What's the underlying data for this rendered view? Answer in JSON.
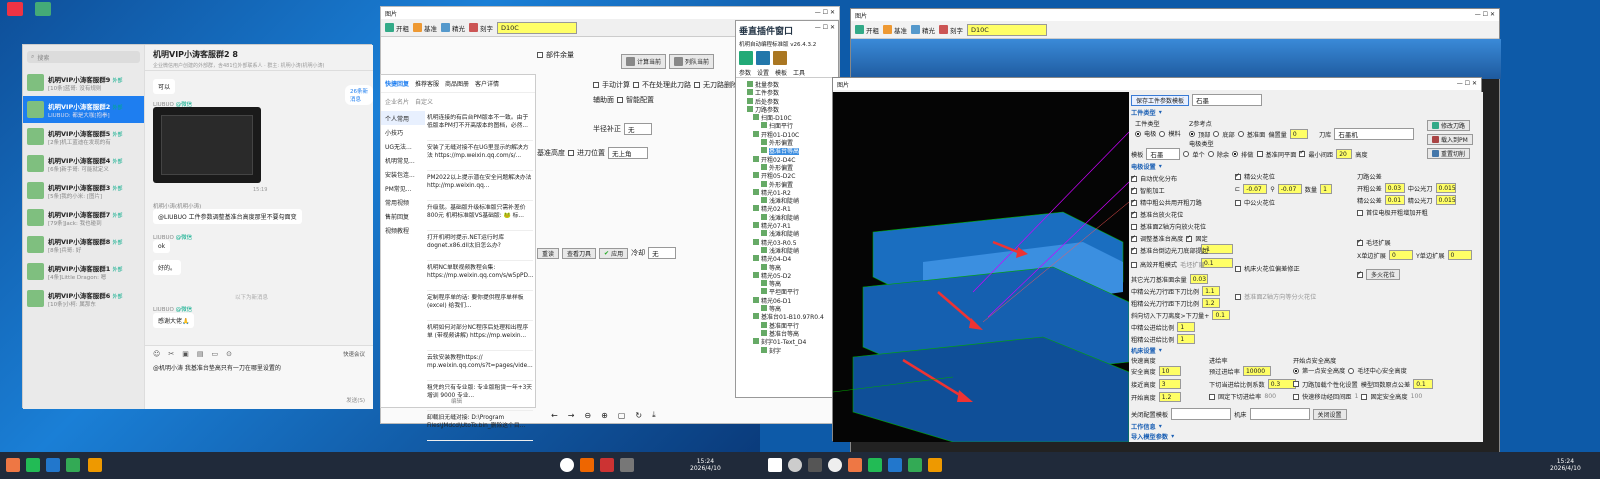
{
  "wechat": {
    "search_placeholder": "搜索",
    "add_icon": "plus-icon",
    "chats": [
      {
        "name": "机明VIP小涛客服群9",
        "badge": "外部",
        "preview": "[10条]蓝哥: 没有规则",
        "time": "",
        "active": false
      },
      {
        "name": "机明VIP小涛客服群2",
        "badge": "外部",
        "preview": "LIUBUO: 都是大咖[抱拳]",
        "time": "",
        "active": true
      },
      {
        "name": "机明VIP小涛客服群5",
        "badge": "外部",
        "preview": "[2条]机工蓝迪在发现的有",
        "time": "",
        "active": false
      },
      {
        "name": "机明VIP小涛客服群4",
        "badge": "外部",
        "preview": "[6条]新手哥: 可能就定义",
        "time": "",
        "active": false
      },
      {
        "name": "机明VIP小涛客服群3",
        "badge": "外部",
        "preview": "[5条]我的小米: [图片]",
        "time": "",
        "active": false
      },
      {
        "name": "机明VIP小涛客服群7",
        "badge": "外部",
        "preview": "[79条]Jack: 我也碰到",
        "time": "",
        "active": false
      },
      {
        "name": "机明VIP小涛客服群8",
        "badge": "外部",
        "preview": "[8条]兵哥: 好",
        "time": "",
        "active": false
      },
      {
        "name": "机明VIP小涛客服群1",
        "badge": "外部",
        "preview": "[4条]Little Dragon: 嗯",
        "time": "",
        "active": false
      },
      {
        "name": "机明VIP小涛客服群6",
        "badge": "外部",
        "preview": "[10条]小柯: 属那东",
        "time": "",
        "active": false
      }
    ],
    "chat_title": "机明VIP小涛客服群2",
    "chat_title_count": "8",
    "chat_subtitle": "企业微信用户创建的外部群，含481位外部联系人 · 群主: 机明小涛(机明小涛)",
    "msg_ok1": "可以",
    "sender1": "LIUBUO",
    "sender_tag": "@微信",
    "img_time": "15:19",
    "sender2": "机明小涛(机明小涛)",
    "msg_quote": "@LIUBUO 工件参数调整基准台高度那里不要勾面变",
    "msg_ok2": "ok",
    "msg_good": "好的。",
    "divider": "以下为新消息",
    "msg_thanks": "感谢大佬🙏",
    "new_msgs": "26条新消息",
    "input_text": "@机明小涛 我基准台垫高只有一刀在哪里设置的",
    "quick_ask": "快速会议",
    "send_button": "发送(S)"
  },
  "quick": {
    "tabs": [
      "快捷回复",
      "推荐客服",
      "商品图册",
      "客户详情"
    ],
    "subtabs": [
      "企业名片",
      "自定义"
    ],
    "categories": [
      "个人常用",
      "小技巧",
      "UG无法...",
      "机明常见...",
      "安装包连...",
      "PM常见...",
      "常用视频",
      "售前回复",
      "视频教程"
    ],
    "items": [
      "机明连接的有后台PM版本不一致。由于低版本PM打不开高版本的图档，必然...",
      "安装了无缝对接不在UG里显示的解决方法 https://mp.weixin.qq.com/s/...",
      "PM2022以上提示潜在安全问题解决办法 http://mp.weixin.qq...",
      "升级就。基础版升级标准版只需补差价800元 机明标准版VS基础版: 🐸 标...",
      "打开机明时提示.NET运行时库 dognet.x86.dll太旧怎么办?",
      "机明NC单联视频教程合集: https://mp.weixin.qq.com/s/w5pPD...",
      "定制程序单的话: 要你提供程序单样板 (excel) 给我们...",
      "机明如何对部分NC程序后处理和出程序单 (带视频讲解) https://mp.weixin...",
      "云软安装教程https:// mp.weixin.qq.com/s?t=pages/vide...",
      "租凭的只有专业版: 专业版租赁一年+3天增训 9000 专业...",
      "卸载旧无缝对接: D:\\Program Files\\JMdcd\\UtoTo.bin_删除这个目..."
    ],
    "edit": "编辑"
  },
  "viewer": {
    "title": "图片",
    "toolbar": [
      "开粗",
      "基准",
      "精光",
      "刻字"
    ],
    "cutter": "D10C",
    "folder_cb": "部件余量",
    "calc_button": "计算当前",
    "list_button": "列队当前",
    "manual_calc": "手动计算",
    "no_reg_tool": "不在处理此刀路",
    "no_tool_del": "无刀路删除",
    "aux_plane": "辅助面",
    "smart_config": "智能配置",
    "half_dia": "半径补正",
    "half_dia_val": "无",
    "base_height": "基准高度",
    "feed_pos": "进刀位置",
    "feed_val": "无上角",
    "reset": "重读",
    "view_tool": "查看刀具",
    "apply": "应用",
    "cool": "冷却",
    "cool_val": "无"
  },
  "plugin": {
    "title": "垂直插件窗口",
    "version": "机明自动编程标准版 v26.4.3.2",
    "tabs": [
      "参数",
      "设置",
      "模板",
      "工具"
    ],
    "tree": [
      {
        "label": "批量参数",
        "hl": false
      },
      {
        "label": "工件参数",
        "hl": false
      },
      {
        "label": "后处参数",
        "hl": false
      },
      {
        "label": "刀路参数",
        "hl": false
      },
      {
        "label": "扫面-D10C",
        "hl": false
      },
      {
        "label": "扫面平行",
        "hl": false
      },
      {
        "label": "开粗01-D10C",
        "hl": false
      },
      {
        "label": "外形偏置",
        "hl": false
      },
      {
        "label": "基准台等高",
        "hl": true
      },
      {
        "label": "开粗02-D4C",
        "hl": false
      },
      {
        "label": "外形偏置",
        "hl": false
      },
      {
        "label": "开粗05-D2C",
        "hl": false
      },
      {
        "label": "外形偏置",
        "hl": false
      },
      {
        "label": "精光01-R2",
        "hl": false
      },
      {
        "label": "浅滩和陡峭",
        "hl": false
      },
      {
        "label": "精光02-R1",
        "hl": false
      },
      {
        "label": "浅滩和陡峭",
        "hl": false
      },
      {
        "label": "精光07-R1",
        "hl": false
      },
      {
        "label": "浅滩和陡峭",
        "hl": false
      },
      {
        "label": "精光03-R0.5",
        "hl": false
      },
      {
        "label": "浅滩和陡峭",
        "hl": false
      },
      {
        "label": "精光04-D4",
        "hl": false
      },
      {
        "label": "等高",
        "hl": false
      },
      {
        "label": "精光05-D2",
        "hl": false
      },
      {
        "label": "等高",
        "hl": false
      },
      {
        "label": "平坦面平行",
        "hl": false
      },
      {
        "label": "精光06-D1",
        "hl": false
      },
      {
        "label": "等高",
        "hl": false
      },
      {
        "label": "基准台01-B10.97R0.4",
        "hl": false
      },
      {
        "label": "基准面平行",
        "hl": false
      },
      {
        "label": "基准台等高",
        "hl": false
      },
      {
        "label": "刻字01-Text_D4",
        "hl": false
      },
      {
        "label": "刻字",
        "hl": false
      }
    ]
  },
  "dialog": {
    "title": "图片",
    "save_template": "保存工件参数模板",
    "template_val": "石墨",
    "sect_workpiece": "工件类型",
    "wp_type": "工件类型",
    "electrode": "电极",
    "steel": "模料",
    "z_ref": "Z参考点",
    "top": "顶部",
    "bottom": "底部",
    "base_plane": "基准面",
    "offset_qty": "偏置量",
    "offset_val": "0",
    "lib": "刀库",
    "lib_val": "石墨机",
    "modify_tool": "修改刀路",
    "load_pm": "载入到PM",
    "reset_cut": "重置切削",
    "mold": "模板",
    "mold_val": "石墨",
    "elec_type": "电极类型",
    "single": "单个",
    "multi": "除余",
    "row": "排做",
    "base_same": "基准同平面",
    "min_arc": "最小间距",
    "min_arc_val": "20",
    "height_label": "高度",
    "sect_elec": "电极设置",
    "opt_auto": "自动优化分布",
    "smart_add": "智能加工",
    "spark_gap": "精公火花位",
    "spark1": "-0.07",
    "spark2": "-0.07",
    "count_label": "数量",
    "count_val": "1",
    "tool_gap": "刀路公差",
    "open_rough": "开粗公差",
    "open_rough_val": "0.03",
    "mid_light": "中公光刀",
    "mid_light_val": "0.015",
    "fine_gap": "精公公差",
    "fine_gap_val": "0.01",
    "fine_light": "精公光刀",
    "fine_light_val": "0.015",
    "head_gap": "首位电极开粗增加开粗",
    "edge_fine": "精中粗公共用开粗刀路",
    "base_fire": "基准台放火花位",
    "base_z": "基准面Z轴方向放火花位",
    "mid_spark": "中公火花位",
    "base_height_adj": "调整基准台高度",
    "fixed": "固定",
    "val_neg1": "-1",
    "base_auto": "基准台倒边光刀底部提起",
    "val_01": "0.1",
    "side_fire": "毛坯扩展",
    "x_expand": "X单边扩展",
    "x_val": "0",
    "y_expand": "Y单边扩展",
    "y_val": "0",
    "multi_fire": "多火花位",
    "high_open": "高效开粗模式",
    "high_open_val": "毛坯扩展",
    "machine_fire": "机床火花位偏差修正",
    "other_light": "其它光刀基准面余量",
    "other_light_val": "0.03",
    "mid_rough": "中精公光刀行距下刀比例",
    "mid_rough_val": "1.1",
    "rough_rough": "粗精公光刀行距下刀比例",
    "rough_rough_val": "1.2",
    "slope": "斜向切入下刀离度>下刀量+",
    "slope_val": "0.1",
    "mid_feed": "中精公进给比例",
    "mid_feed_val": "1",
    "rough_feed": "粗精公进给比例",
    "rough_feed_val": "1",
    "base_z2": "基准面Z轴方向等分火花位",
    "sect_machine": "机床设置",
    "fast_h": "快速高度",
    "safe_h": "安全高度",
    "safe_val": "10",
    "feed_rate": "进给率",
    "plunge_rate": "预过进给率",
    "plunge_val": "10000",
    "start_safe": "开始点安全高度",
    "first_safe": "第一点安全高度",
    "mid_safe": "毛坯中心安全高度",
    "clear_h": "接近高度",
    "clear_val": "3",
    "lift_ratio": "下切当进给比例系数",
    "lift_val": "0.3",
    "tool_personal": "刀路加载个性化设置",
    "mold_close": "模型回数原点公差",
    "mold_close_val": "0.1",
    "start_h": "开始高度",
    "start_val": "1.2",
    "fixed_lift": "固定下切进给率",
    "fixed_lift_val": "800",
    "fast_move": "快速移动经回间距",
    "fast_move_val": "1",
    "fixed_safe": "固定安全高度",
    "fixed_safe_val": "100",
    "match_template": "关闭配置模板",
    "machine": "机床",
    "close_btn": "关闭设置",
    "sect_info": "工作信息",
    "sect_import": "导入模型参数"
  },
  "taskbar": {
    "time_left": "15:24",
    "date_left": "2026/4/10",
    "time_right": "15:24",
    "date_right": "2026/4/10"
  },
  "colors": {
    "accent": "#1e7ef0",
    "yellow_field": "#ffff66",
    "cad_blue": "#2a8ad8"
  }
}
